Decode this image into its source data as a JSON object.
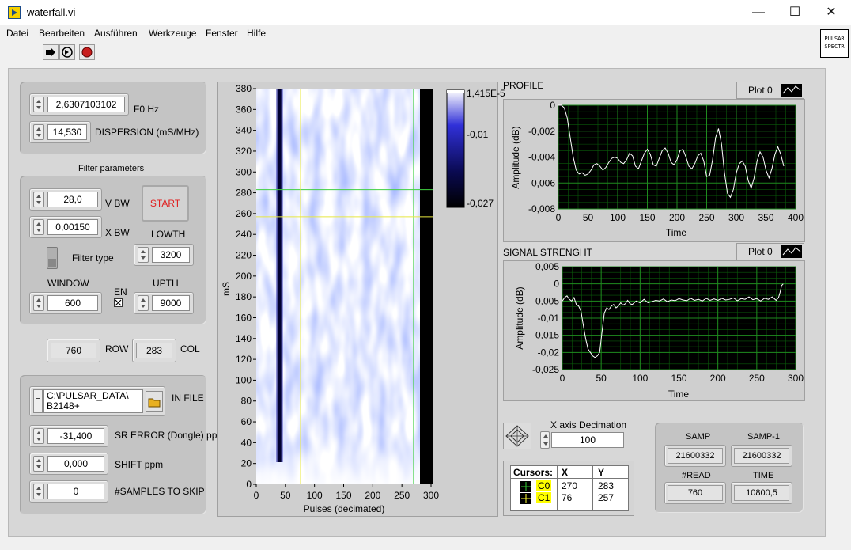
{
  "window": {
    "title": "waterfall.vi",
    "minimize": "—",
    "maximize": "☐",
    "close": "✕"
  },
  "menu": [
    "Datei",
    "Bearbeiten",
    "Ausführen",
    "Werkzeuge",
    "Fenster",
    "Hilfe"
  ],
  "toolbar": {
    "icons": [
      "run-arrow-icon",
      "run-continuous-icon",
      "abort-icon"
    ]
  },
  "vi_icon": {
    "line1": "PULSAR",
    "line2": "SPECTR"
  },
  "params": {
    "f0": {
      "value": "2,6307103102",
      "label": "F0 Hz"
    },
    "dispersion": {
      "value": "14,530",
      "label": "DISPERSION (mS/MHz)"
    }
  },
  "filter": {
    "title": "Filter parameters",
    "vbw": {
      "value": "28,0",
      "label": "V BW"
    },
    "xbw": {
      "value": "0,00150",
      "label": "X BW"
    },
    "start_label": "START",
    "lowth": {
      "label": "LOWTH",
      "value": "3200"
    },
    "filter_type_label": "Filter type",
    "window": {
      "label": "WINDOW",
      "value": "600"
    },
    "en_label": "EN",
    "upth": {
      "label": "UPTH",
      "value": "9000"
    }
  },
  "rowcol": {
    "row_value": "760",
    "row_label": "ROW",
    "col_value": "283",
    "col_label": "COL"
  },
  "file": {
    "path_line1": "C:\\PULSAR_DATA\\",
    "path_line2": "B2148+",
    "label": "IN FILE",
    "sr_error": {
      "value": "-31,400",
      "label": "SR ERROR (Dongle) ppm"
    },
    "shift": {
      "value": "0,000",
      "label": "SHIFT ppm"
    },
    "skip": {
      "value": "0",
      "label": "#SAMPLES TO SKIP"
    }
  },
  "waterfall": {
    "ylabel": "mS",
    "xlabel": "Pulses (decimated)",
    "y_ticks": [
      "380",
      "360",
      "340",
      "320",
      "300",
      "280",
      "260",
      "240",
      "220",
      "200",
      "180",
      "160",
      "140",
      "120",
      "100",
      "80",
      "60",
      "40",
      "20",
      "0"
    ],
    "x_ticks": [
      "0",
      "50",
      "100",
      "150",
      "200",
      "250",
      "300"
    ],
    "scale_ticks": [
      "1,415E-5",
      "-0,01",
      "-0,027"
    ],
    "cursor_c0": {
      "x": 270,
      "y": 283
    },
    "cursor_c1": {
      "x": 76,
      "y": 257
    }
  },
  "profile": {
    "title": "PROFILE",
    "legend": "Plot 0",
    "ylabel": "Amplitude (dB)",
    "xlabel": "Time",
    "y_ticks": [
      "0",
      "-0,002",
      "-0,004",
      "-0,006",
      "-0,008"
    ],
    "x_ticks": [
      "0",
      "50",
      "100",
      "150",
      "200",
      "250",
      "300",
      "350",
      "400"
    ]
  },
  "signal": {
    "title": "SIGNAL STRENGHT",
    "legend": "Plot 0",
    "ylabel": "Amplitude (dB)",
    "xlabel": "Time",
    "y_ticks": [
      "0,005",
      "0",
      "-0,005",
      "-0,01",
      "-0,015",
      "-0,02",
      "-0,025"
    ],
    "x_ticks": [
      "0",
      "50",
      "100",
      "150",
      "200",
      "250",
      "300"
    ]
  },
  "decimation": {
    "label": "X axis Decimation",
    "value": "100"
  },
  "cursors": {
    "header": [
      "Cursors:",
      "X",
      "Y"
    ],
    "rows": [
      {
        "name": "C0",
        "x": "270",
        "y": "283"
      },
      {
        "name": "C1",
        "x": "76",
        "y": "257"
      }
    ]
  },
  "stats": {
    "samp_label": "SAMP",
    "samp_value": "21600332",
    "samp1_label": "SAMP-1",
    "samp1_value": "21600332",
    "read_label": "#READ",
    "read_value": "760",
    "time_label": "TIME",
    "time_value": "10800,5"
  },
  "chart_data": [
    {
      "type": "heatmap",
      "title": "",
      "xlabel": "Pulses (decimated)",
      "ylabel": "mS",
      "xlim": [
        0,
        300
      ],
      "ylim": [
        0,
        380
      ],
      "colorbar": {
        "max": 1.415e-05,
        "mid": -0.01,
        "min": -0.027
      },
      "description_band": {
        "x_center": 40,
        "x_width": 12
      }
    },
    {
      "type": "line",
      "title": "PROFILE",
      "xlabel": "Time",
      "ylabel": "Amplitude (dB)",
      "xlim": [
        0,
        400
      ],
      "ylim": [
        -0.008,
        0
      ],
      "series": [
        {
          "name": "Plot 0",
          "x": [
            0,
            5,
            10,
            15,
            20,
            25,
            30,
            35,
            40,
            45,
            50,
            55,
            60,
            65,
            70,
            75,
            80,
            85,
            90,
            95,
            100,
            105,
            110,
            115,
            120,
            125,
            130,
            135,
            140,
            145,
            150,
            155,
            160,
            165,
            170,
            175,
            180,
            185,
            190,
            195,
            200,
            205,
            210,
            215,
            220,
            225,
            230,
            235,
            240,
            245,
            250,
            255,
            260,
            265,
            270,
            275,
            280,
            285,
            290,
            295,
            300,
            305,
            310,
            315,
            320,
            325,
            330,
            335,
            340,
            345,
            350,
            355,
            360,
            365,
            370,
            375,
            380
          ],
          "y": [
            0,
            0,
            -0.0002,
            -0.001,
            -0.0025,
            -0.004,
            -0.005,
            -0.0053,
            -0.0052,
            -0.0054,
            -0.0053,
            -0.005,
            -0.0046,
            -0.0045,
            -0.0047,
            -0.005,
            -0.0048,
            -0.0044,
            -0.0041,
            -0.004,
            -0.0041,
            -0.0044,
            -0.0045,
            -0.0042,
            -0.0037,
            -0.0039,
            -0.0047,
            -0.0049,
            -0.0043,
            -0.0037,
            -0.0034,
            -0.0038,
            -0.0046,
            -0.0047,
            -0.0041,
            -0.0035,
            -0.0033,
            -0.0037,
            -0.0044,
            -0.0046,
            -0.0042,
            -0.0035,
            -0.0034,
            -0.004,
            -0.0047,
            -0.0049,
            -0.0045,
            -0.0039,
            -0.0037,
            -0.0043,
            -0.0055,
            -0.0054,
            -0.0042,
            -0.0025,
            -0.0018,
            -0.003,
            -0.0052,
            -0.0068,
            -0.0071,
            -0.0065,
            -0.0052,
            -0.0045,
            -0.0043,
            -0.0047,
            -0.0058,
            -0.0064,
            -0.0056,
            -0.0043,
            -0.0036,
            -0.004,
            -0.005,
            -0.0056,
            -0.0049,
            -0.0038,
            -0.0032,
            -0.0038,
            -0.0047
          ]
        }
      ]
    },
    {
      "type": "line",
      "title": "SIGNAL STRENGHT",
      "xlabel": "Time",
      "ylabel": "Amplitude (dB)",
      "xlim": [
        0,
        300
      ],
      "ylim": [
        -0.025,
        0.005
      ],
      "series": [
        {
          "name": "Plot 0",
          "x": [
            0,
            3,
            6,
            9,
            12,
            15,
            18,
            21,
            24,
            27,
            30,
            33,
            36,
            39,
            42,
            45,
            48,
            51,
            54,
            57,
            60,
            63,
            66,
            69,
            72,
            75,
            78,
            81,
            84,
            87,
            90,
            95,
            100,
            105,
            110,
            115,
            120,
            125,
            130,
            135,
            140,
            145,
            150,
            155,
            160,
            165,
            170,
            175,
            180,
            185,
            190,
            195,
            200,
            205,
            210,
            215,
            220,
            225,
            230,
            235,
            240,
            245,
            250,
            255,
            260,
            265,
            270,
            275,
            278,
            280,
            282,
            284
          ],
          "y": [
            -0.005,
            -0.004,
            -0.0035,
            -0.0045,
            -0.005,
            -0.004,
            -0.006,
            -0.0065,
            -0.008,
            -0.012,
            -0.016,
            -0.019,
            -0.02,
            -0.021,
            -0.0215,
            -0.021,
            -0.02,
            -0.014,
            -0.0085,
            -0.007,
            -0.0075,
            -0.0065,
            -0.006,
            -0.007,
            -0.0065,
            -0.0055,
            -0.0062,
            -0.0058,
            -0.0048,
            -0.0058,
            -0.006,
            -0.005,
            -0.0055,
            -0.0045,
            -0.0055,
            -0.0052,
            -0.0048,
            -0.005,
            -0.0044,
            -0.0052,
            -0.0047,
            -0.0049,
            -0.0043,
            -0.0047,
            -0.0049,
            -0.0042,
            -0.0048,
            -0.0045,
            -0.005,
            -0.0042,
            -0.0048,
            -0.0044,
            -0.0048,
            -0.0042,
            -0.0047,
            -0.0045,
            -0.0041,
            -0.0049,
            -0.0043,
            -0.0045,
            -0.0038,
            -0.0046,
            -0.0043,
            -0.005,
            -0.0042,
            -0.0045,
            -0.0038,
            -0.0048,
            -0.004,
            -0.0025,
            -0.0005,
            0
          ]
        }
      ]
    }
  ]
}
